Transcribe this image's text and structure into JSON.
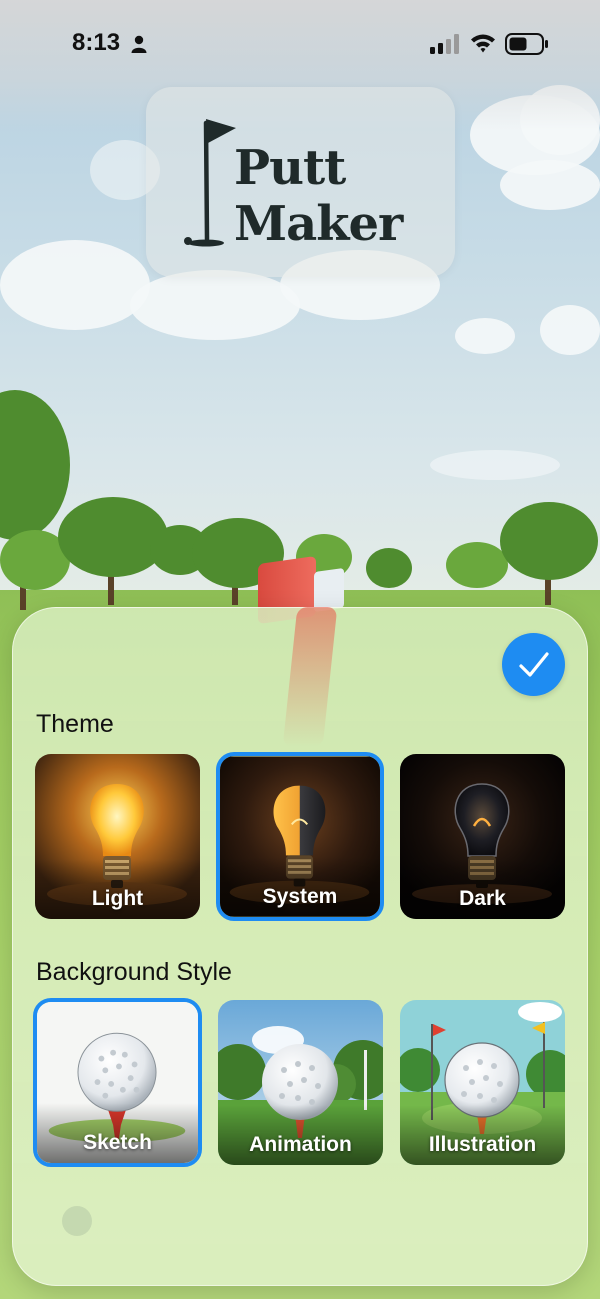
{
  "status_bar": {
    "time": "8:13",
    "icons": [
      "person-icon",
      "signal-icon",
      "wifi-icon",
      "battery-icon"
    ]
  },
  "logo": {
    "line1": "Putt",
    "line2": "Maker",
    "icon": "golf-flag-icon"
  },
  "sheet": {
    "done_icon": "checkmark-icon",
    "accent_color": "#1e8cf2",
    "theme": {
      "title": "Theme",
      "selected": "System",
      "options": [
        {
          "label": "Light",
          "icon": "light-bulb-icon"
        },
        {
          "label": "System",
          "icon": "light-bulb-icon"
        },
        {
          "label": "Dark",
          "icon": "light-bulb-icon"
        }
      ]
    },
    "background_style": {
      "title": "Background Style",
      "selected": "Sketch",
      "options": [
        {
          "label": "Sketch",
          "icon": "golf-ball-icon"
        },
        {
          "label": "Animation",
          "icon": "golf-ball-icon"
        },
        {
          "label": "Illustration",
          "icon": "golf-ball-icon"
        }
      ]
    }
  }
}
